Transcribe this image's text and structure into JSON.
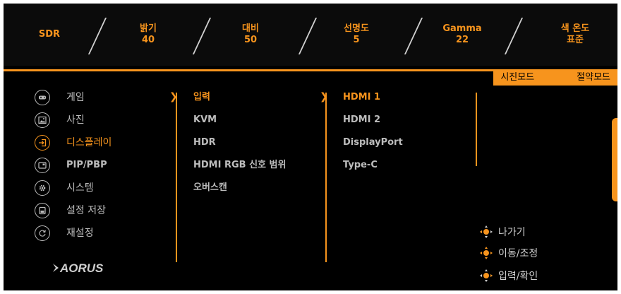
{
  "topbar": {
    "mode": "SDR",
    "brightness": {
      "label": "밝기",
      "value": "40"
    },
    "contrast": {
      "label": "대비",
      "value": "50"
    },
    "sharpness": {
      "label": "선명도",
      "value": "5"
    },
    "gamma": {
      "label": "Gamma",
      "value": "22"
    },
    "color_temp": {
      "label": "색 온도",
      "value": "표준"
    }
  },
  "mode_tabs": {
    "tab1": "시진모드",
    "tab2": "절약모드"
  },
  "main_menu": [
    {
      "label": "게임",
      "icon": "gamepad-icon"
    },
    {
      "label": "사진",
      "icon": "picture-icon"
    },
    {
      "label": "디스플레이",
      "icon": "input-icon"
    },
    {
      "label": "PIP/PBP",
      "icon": "pip-icon"
    },
    {
      "label": "시스템",
      "icon": "gear-icon"
    },
    {
      "label": "설정 저장",
      "icon": "save-icon"
    },
    {
      "label": "재설정",
      "icon": "reset-icon"
    }
  ],
  "display_submenu": [
    "입력",
    "KVM",
    "HDR",
    "HDMI RGB 신호 범위",
    "오버스캔"
  ],
  "input_options": [
    "HDMI 1",
    "HDMI 2",
    "DisplayPort",
    "Type-C"
  ],
  "logo": "AORUS",
  "hints": [
    "나가기",
    "이동/조정",
    "입력/확인"
  ],
  "colors": {
    "accent": "#f7941d",
    "background": "#000000",
    "text": "#bdbdbd"
  }
}
